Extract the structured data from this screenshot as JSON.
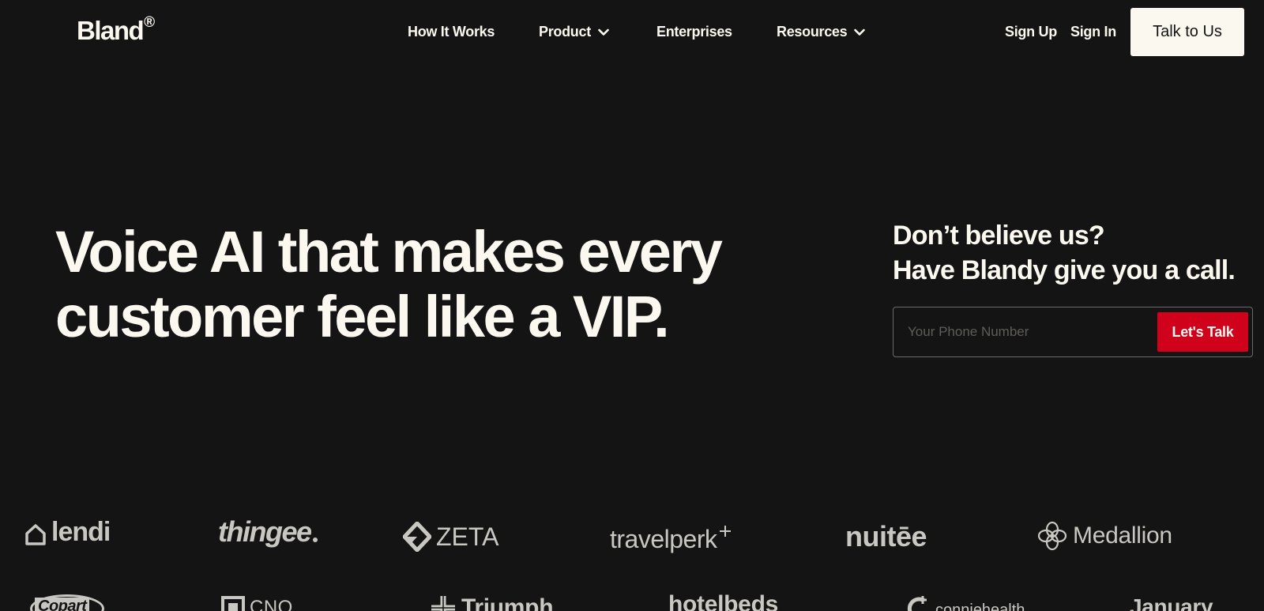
{
  "nav": {
    "brand": "Bland",
    "brand_mark": "®",
    "links": [
      {
        "label": "How It Works"
      },
      {
        "label": "Product",
        "icon": "chevron-down-icon"
      },
      {
        "label": "Enterprises"
      },
      {
        "label": "Resources",
        "icon": "chevron-down-icon"
      }
    ],
    "sign_up": "Sign Up",
    "sign_in": "Sign In",
    "talk_button": "Talk to Us"
  },
  "hero": {
    "title_line1": "Voice AI that makes every",
    "title_line2": "customer feel like a VIP.",
    "cta_line1": "Don’t believe us?",
    "cta_line2": "Have Blandy give you a call.",
    "phone_placeholder": "Your Phone Number",
    "submit_label": "Let's Talk"
  },
  "colors": {
    "background": "#141414",
    "text": "#fbf8ef",
    "accent_red": "#d0021b",
    "logo_gray": "#c9c7c2"
  },
  "customer_logos": {
    "row1": [
      "lendi",
      "thingee",
      "ZETA",
      "travelperk",
      "nuitēe",
      "Medallion"
    ],
    "row2": [
      "Copart",
      "CNO",
      "Triumph",
      "hotelbeds",
      "conniehealth",
      "January"
    ]
  }
}
